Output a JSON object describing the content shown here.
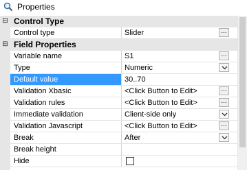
{
  "title": "Properties",
  "categories": {
    "control_type": "Control Type",
    "field_properties": "Field Properties"
  },
  "rows": [
    {
      "name": "Control type",
      "value": "Slider"
    },
    {
      "name": "Variable name",
      "value": "S1"
    },
    {
      "name": "Type",
      "value": "Numeric"
    },
    {
      "name": "Default value",
      "value": "30..70"
    },
    {
      "name": "Validation Xbasic",
      "value": "<Click Button to Edit>"
    },
    {
      "name": "Validation rules",
      "value": "<Click Button to Edit>"
    },
    {
      "name": "Immediate validation",
      "value": "Client-side only"
    },
    {
      "name": "Validation Javascript",
      "value": "<Click Button to Edit>"
    },
    {
      "name": "Break",
      "value": "After"
    },
    {
      "name": "Break height",
      "value": ""
    },
    {
      "name": "Hide",
      "value": ""
    }
  ],
  "icons": {
    "title": "magnifier-icon",
    "ellipsis": "...",
    "collapse": "minus"
  }
}
